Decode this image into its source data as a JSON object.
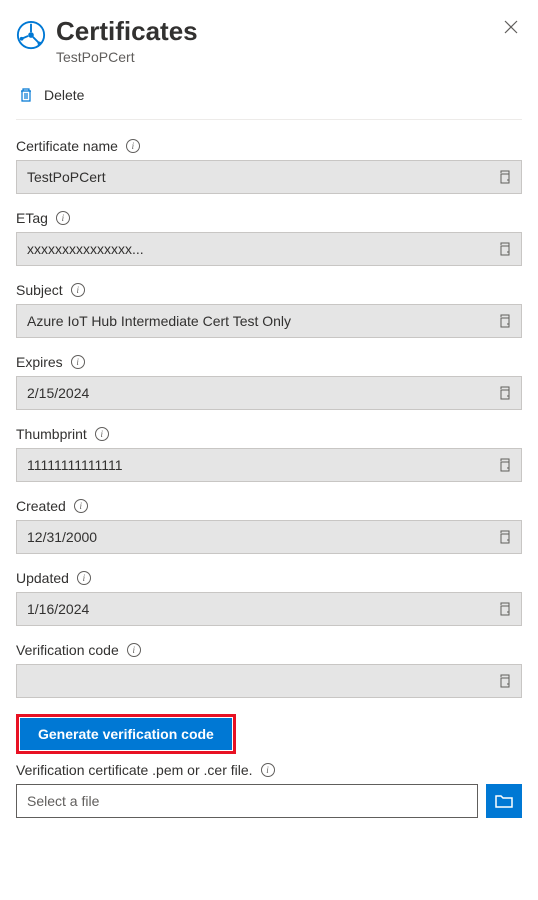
{
  "header": {
    "title": "Certificates",
    "subtitle": "TestPoPCert"
  },
  "toolbar": {
    "delete_label": "Delete"
  },
  "fields": {
    "certificate_name": {
      "label": "Certificate name",
      "value": "TestPoPCert"
    },
    "etag": {
      "label": "ETag",
      "value": "xxxxxxxxxxxxxxx..."
    },
    "subject": {
      "label": "Subject",
      "value": "Azure IoT Hub Intermediate Cert Test Only"
    },
    "expires": {
      "label": "Expires",
      "value": "2/15/2024"
    },
    "thumbprint": {
      "label": "Thumbprint",
      "value": "11111111111111"
    },
    "created": {
      "label": "Created",
      "value": "12/31/2000"
    },
    "updated": {
      "label": "Updated",
      "value": "1/16/2024"
    },
    "verification_code": {
      "label": "Verification code",
      "value": ""
    },
    "verification_file": {
      "label": "Verification certificate .pem or .cer file.",
      "placeholder": "Select a file"
    }
  },
  "actions": {
    "generate_label": "Generate verification code"
  }
}
